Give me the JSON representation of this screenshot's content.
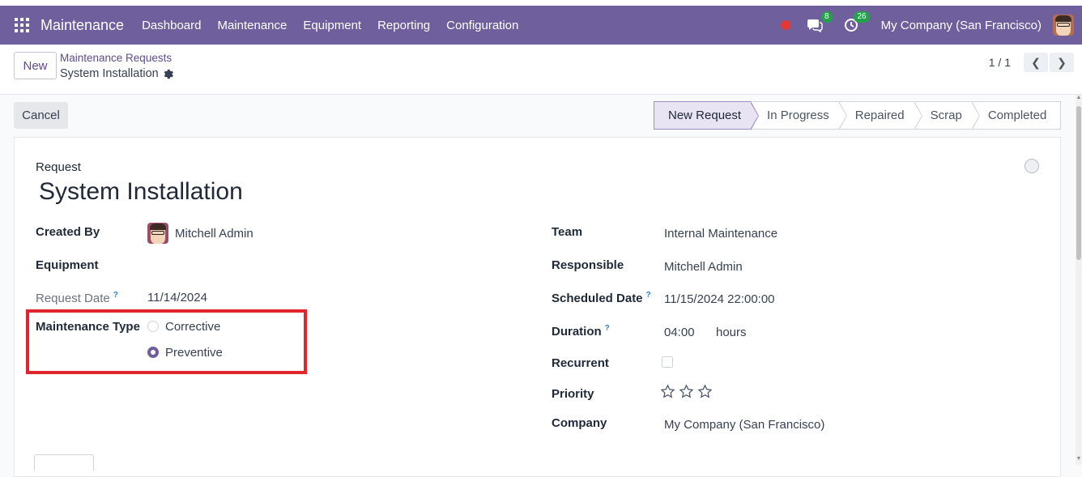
{
  "navbar": {
    "app_name": "Maintenance",
    "menu": [
      "Dashboard",
      "Maintenance",
      "Equipment",
      "Reporting",
      "Configuration"
    ],
    "messages_count": "8",
    "activities_count": "26",
    "company": "My Company (San Francisco)",
    "bg_color": "#6f5f9c"
  },
  "control_panel": {
    "new_label": "New",
    "breadcrumb_parent": "Maintenance Requests",
    "breadcrumb_current": "System Installation",
    "pager": "1 / 1"
  },
  "actions": {
    "cancel_label": "Cancel"
  },
  "stages": [
    "New Request",
    "In Progress",
    "Repaired",
    "Scrap",
    "Completed"
  ],
  "active_stage": "New Request",
  "form": {
    "request_label": "Request",
    "title": "System Installation",
    "left": {
      "created_by_label": "Created By",
      "created_by_value": "Mitchell Admin",
      "equipment_label": "Equipment",
      "request_date_label": "Request Date",
      "request_date_value": "11/14/2024",
      "maintenance_type_label": "Maintenance Type",
      "type_options": [
        "Corrective",
        "Preventive"
      ],
      "type_selected": "Preventive"
    },
    "right": {
      "team_label": "Team",
      "team_value": "Internal Maintenance",
      "responsible_label": "Responsible",
      "responsible_value": "Mitchell Admin",
      "scheduled_label": "Scheduled Date",
      "scheduled_value": "11/15/2024 22:00:00",
      "duration_label": "Duration",
      "duration_value": "04:00",
      "duration_unit": "hours",
      "recurrent_label": "Recurrent",
      "recurrent_checked": false,
      "priority_label": "Priority",
      "priority_stars": 0,
      "company_label": "Company",
      "company_value": "My Company (San Francisco)"
    },
    "help_mark": "?"
  },
  "colors": {
    "accent": "#6f5f9c",
    "highlight": "#e0252d",
    "badge": "#22a34a"
  }
}
